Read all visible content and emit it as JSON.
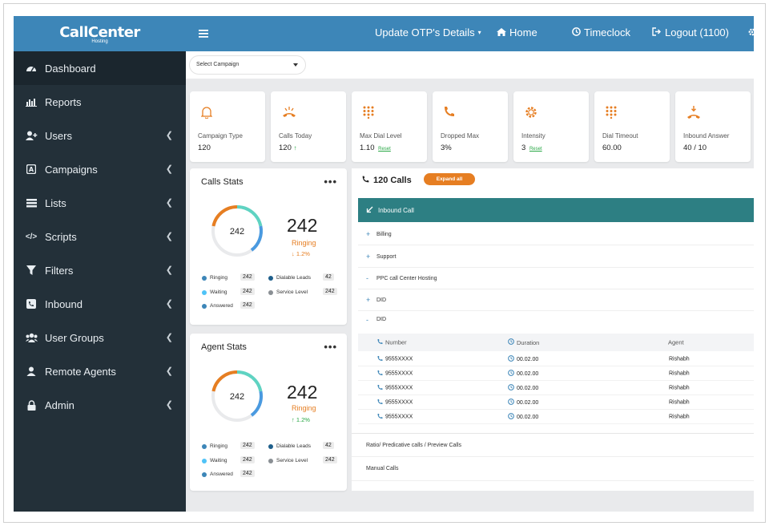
{
  "brand": {
    "logo_main": "CallCenter",
    "logo_sub": "Hosting"
  },
  "colors": {
    "primary": "#3d86b8",
    "sidebar": "#233039",
    "accent": "#e67e22",
    "teal": "#2d7f83",
    "success": "#28a745"
  },
  "sidebar": {
    "items": [
      {
        "label": "Dashboard",
        "icon": "dashboard-icon"
      },
      {
        "label": "Reports",
        "icon": "bar-chart-icon"
      },
      {
        "label": "Users",
        "icon": "user-plus-icon"
      },
      {
        "label": "Campaigns",
        "icon": "campaign-icon"
      },
      {
        "label": "Lists",
        "icon": "list-icon"
      },
      {
        "label": "Scripts",
        "icon": "code-icon"
      },
      {
        "label": "Filters",
        "icon": "filter-icon"
      },
      {
        "label": "Inbound",
        "icon": "phone-square-icon"
      },
      {
        "label": "User Groups",
        "icon": "users-icon"
      },
      {
        "label": "Remote Agents",
        "icon": "user-icon"
      },
      {
        "label": "Admin",
        "icon": "lock-icon"
      }
    ]
  },
  "topbar": {
    "otp": "Update OTP's Details",
    "home": "Home",
    "timeclock": "Timeclock",
    "logout": "Logout (1100)"
  },
  "campaign_select": {
    "value": "Select Campaign"
  },
  "stats": [
    {
      "label": "Campaign Type",
      "value": "120",
      "icon": "bell-icon"
    },
    {
      "label": "Calls Today",
      "value": "120",
      "icon": "ringing-phone-icon",
      "trend": "↑"
    },
    {
      "label": "Max Dial Level",
      "value": "1.10",
      "icon": "dialpad-icon",
      "reset": "Reset"
    },
    {
      "label": "Dropped Max",
      "value": "3%",
      "icon": "phone-icon"
    },
    {
      "label": "Intensity",
      "value": "3",
      "icon": "gear-icon",
      "reset": "Reset"
    },
    {
      "label": "Dial Timeout",
      "value": "60.00",
      "icon": "dialpad-icon"
    },
    {
      "label": "Inbound Answer",
      "value": "40 / 10",
      "icon": "incoming-call-icon"
    }
  ],
  "calls_stats": {
    "title": "Calls Stats",
    "donut_value": "242",
    "big_value": "242",
    "big_label": "Ringing",
    "delta": "↓ 1.2%",
    "legend": [
      {
        "label": "Ringing",
        "value": "242",
        "color": "#3d86b8"
      },
      {
        "label": "Dialable Leads",
        "value": "42",
        "color": "#1f5f8b"
      },
      {
        "label": "Waiting",
        "value": "242",
        "color": "#4fc3f7"
      },
      {
        "label": "Service Level",
        "value": "242",
        "color": "#8a8f94"
      },
      {
        "label": "Answered",
        "value": "242",
        "color": "#3d86b8"
      }
    ]
  },
  "agent_stats": {
    "title": "Agent Stats",
    "donut_value": "242",
    "big_value": "242",
    "big_label": "Ringing",
    "delta": "↑ 1.2%",
    "legend": [
      {
        "label": "Ringing",
        "value": "242",
        "color": "#3d86b8"
      },
      {
        "label": "Dialable Leads",
        "value": "42",
        "color": "#1f5f8b"
      },
      {
        "label": "Waiting",
        "value": "242",
        "color": "#4fc3f7"
      },
      {
        "label": "Service Level",
        "value": "242",
        "color": "#8a8f94"
      },
      {
        "label": "Answered",
        "value": "242",
        "color": "#3d86b8"
      }
    ]
  },
  "calls_panel": {
    "title": "120 Calls",
    "expand_label": "Expand all",
    "inbound_label": "Inbound Call",
    "tree": [
      {
        "marker": "+",
        "label": "Billing"
      },
      {
        "marker": "+",
        "label": "Support"
      },
      {
        "marker": "-",
        "label": "PPC call Center Hosting"
      },
      {
        "marker": "+",
        "label": "DID"
      },
      {
        "marker": "-",
        "label": "DID"
      }
    ],
    "columns": {
      "number": "Number",
      "duration": "Duration",
      "agent": "Agent"
    },
    "rows": [
      {
        "number": "9555XXXX",
        "duration": "00.02.00",
        "agent": "Rishabh"
      },
      {
        "number": "9555XXXX",
        "duration": "00.02.00",
        "agent": "Rishabh"
      },
      {
        "number": "9555XXXX",
        "duration": "00.02.00",
        "agent": "Rishabh"
      },
      {
        "number": "9555XXXX",
        "duration": "00.02.00",
        "agent": "Rishabh"
      },
      {
        "number": "9555XXXX",
        "duration": "00.02.00",
        "agent": "Rishabh"
      }
    ],
    "footer_rows": [
      "Ratio/ Predicative calls / Preview Calls",
      "Manual Calls"
    ]
  }
}
